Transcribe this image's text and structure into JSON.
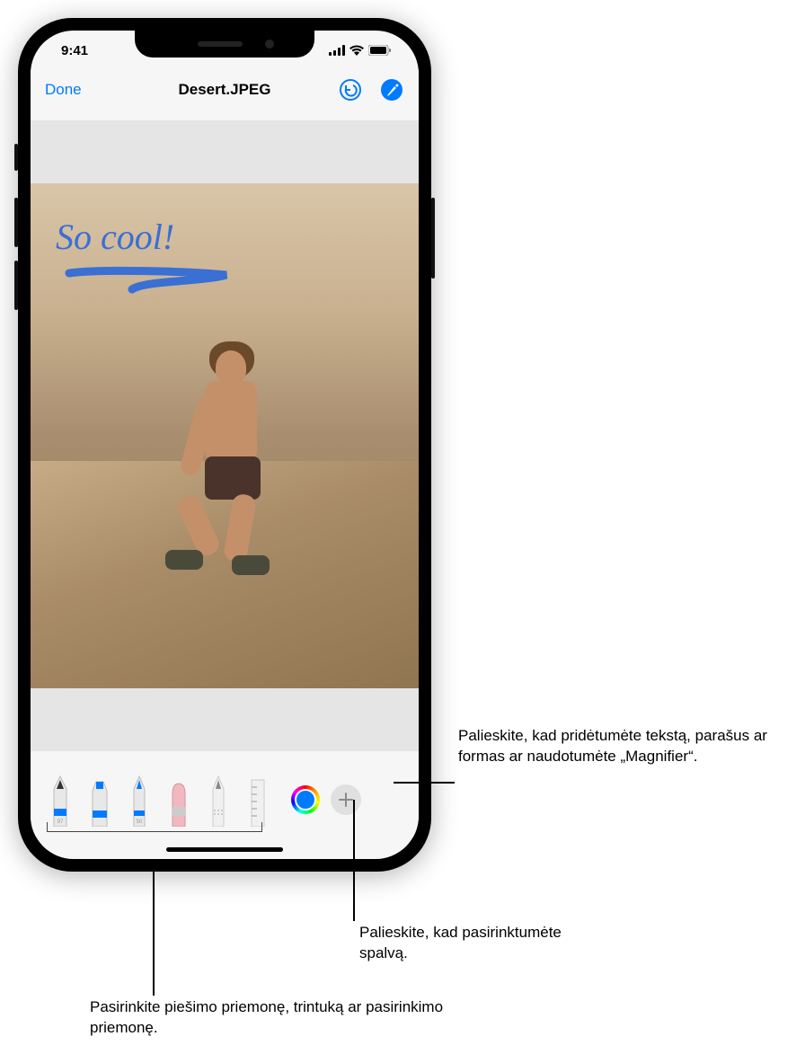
{
  "status": {
    "time": "9:41"
  },
  "nav": {
    "done": "Done",
    "title": "Desert.JPEG"
  },
  "markup": {
    "annotation_text": "So cool!"
  },
  "tools": {
    "pen_label": "97",
    "pencil_label": "50"
  },
  "callouts": {
    "add": "Palieskite, kad pridėtumėte tekstą, parašus ar formas ar naudotumėte „Magnifier“.",
    "color": "Palieskite, kad pasirinktumėte spalvą.",
    "tools": "Pasirinkite piešimo priemonę, trintuką ar pasirinkimo priemonę."
  }
}
